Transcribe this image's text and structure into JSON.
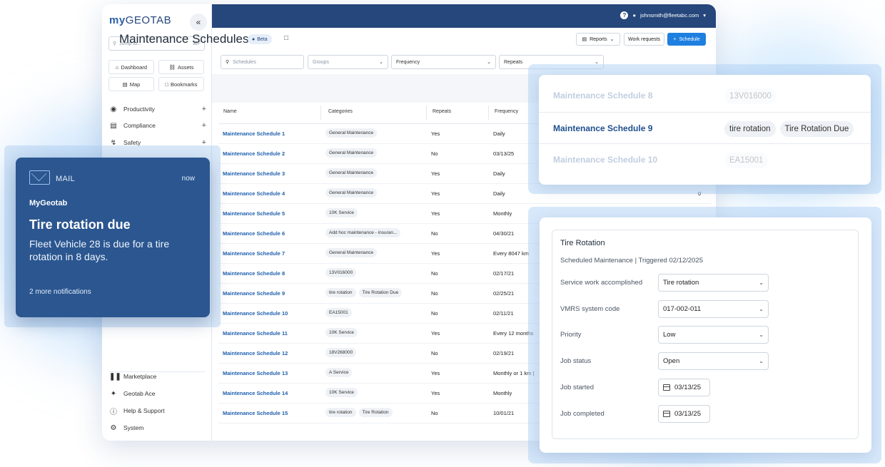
{
  "logo": {
    "my": "my",
    "geo": "GEOTAB"
  },
  "sidebar": {
    "collapse": "«",
    "jump_placeholder": "Jump to...",
    "jump_kbd": "⌘F",
    "quick": [
      {
        "label": "Dashboard",
        "icon": "home-icon"
      },
      {
        "label": "Assets",
        "icon": "truck-icon"
      },
      {
        "label": "Map",
        "icon": "map-icon"
      },
      {
        "label": "Bookmarks",
        "icon": "bookmark-icon"
      }
    ],
    "nav": [
      {
        "label": "Productivity",
        "icon": "globe-icon"
      },
      {
        "label": "Compliance",
        "icon": "clipboard-icon"
      },
      {
        "label": "Safety",
        "icon": "route-icon"
      }
    ],
    "bottom": [
      {
        "label": "Marketplace",
        "icon": "marketplace-icon"
      },
      {
        "label": "Geotab Ace",
        "icon": "sparkle-icon"
      },
      {
        "label": "Help & Support",
        "icon": "help-icon"
      },
      {
        "label": "System",
        "icon": "gear-icon"
      }
    ]
  },
  "topbar": {
    "help": "?",
    "user": "johnsmith@fleetabc.com",
    "caret": "▾"
  },
  "page": {
    "title": "Maintenance Schedules",
    "beta": "Beta",
    "reports": "Reports",
    "work_requests": "Work requests",
    "schedule": "Schedule"
  },
  "filters": {
    "schedules": "Schedules",
    "groups": "Groups",
    "frequency": "Frequency",
    "repeats": "Repeats"
  },
  "table": {
    "headers": {
      "name": "Name",
      "categories": "Categories",
      "repeats": "Repeats",
      "frequency": "Frequency"
    },
    "rows": [
      {
        "name": "Maintenance Schedule 1",
        "cats": [
          "General Maintenance"
        ],
        "repeats": "Yes",
        "freq": "Daily",
        "count": ""
      },
      {
        "name": "Maintenance Schedule 2",
        "cats": [
          "General Maintenance"
        ],
        "repeats": "No",
        "freq": "03/13/25",
        "count": ""
      },
      {
        "name": "Maintenance Schedule 3",
        "cats": [
          "General Maintenance"
        ],
        "repeats": "Yes",
        "freq": "Daily",
        "count": ""
      },
      {
        "name": "Maintenance Schedule 4",
        "cats": [
          "General Maintenance"
        ],
        "repeats": "Yes",
        "freq": "Daily",
        "count": "0"
      },
      {
        "name": "Maintenance Schedule 5",
        "cats": [
          "10K Service"
        ],
        "repeats": "Yes",
        "freq": "Monthly",
        "count": ""
      },
      {
        "name": "Maintenance Schedule 6",
        "cats": [
          "Add hoc maintenance - insuran..."
        ],
        "repeats": "No",
        "freq": "04/30/21",
        "count": ""
      },
      {
        "name": "Maintenance Schedule 7",
        "cats": [
          "General Maintenance"
        ],
        "repeats": "Yes",
        "freq": "Every 8047 km",
        "count": ""
      },
      {
        "name": "Maintenance Schedule 8",
        "cats": [
          "13V016000"
        ],
        "repeats": "No",
        "freq": "02/17/21",
        "count": ""
      },
      {
        "name": "Maintenance Schedule 9",
        "cats": [
          "tire rotation",
          "Tire Rotation Due"
        ],
        "repeats": "No",
        "freq": "02/25/21",
        "count": ""
      },
      {
        "name": "Maintenance Schedule 10",
        "cats": [
          "EA15001"
        ],
        "repeats": "No",
        "freq": "02/11/21",
        "count": ""
      },
      {
        "name": "Maintenance Schedule 11",
        "cats": [
          "10K Service"
        ],
        "repeats": "Yes",
        "freq": "Every 12 months",
        "count": ""
      },
      {
        "name": "Maintenance Schedule 12",
        "cats": [
          "18V268000"
        ],
        "repeats": "No",
        "freq": "02/19/21",
        "count": ""
      },
      {
        "name": "Maintenance Schedule 13",
        "cats": [
          "A Service"
        ],
        "repeats": "Yes",
        "freq": "Monthly or 1 km (",
        "count": ""
      },
      {
        "name": "Maintenance Schedule 14",
        "cats": [
          "10K Service"
        ],
        "repeats": "Yes",
        "freq": "Monthly",
        "count": ""
      },
      {
        "name": "Maintenance Schedule 15",
        "cats": [
          "tire rotation",
          "Tire Rotation"
        ],
        "repeats": "No",
        "freq": "10/01/21",
        "count": ""
      }
    ]
  },
  "notification": {
    "app": "MAIL",
    "time": "now",
    "sender": "MyGeotab",
    "title": "Tire rotation due",
    "body": "Fleet Vehicle 28 is due for a tire rotation in 8 days.",
    "more": "2 more notifications"
  },
  "schedule_card": {
    "rows": [
      {
        "name": "Maintenance Schedule 8",
        "cats": [
          "13V016000"
        ]
      },
      {
        "name": "Maintenance Schedule 9",
        "cats": [
          "tire rotation",
          "Tire Rotation Due"
        ]
      },
      {
        "name": "Maintenance Schedule 10",
        "cats": [
          "EA15001"
        ]
      }
    ]
  },
  "form": {
    "title": "Tire Rotation",
    "subtitle": "Scheduled Maintenance | Triggered 02/12/2025",
    "fields": {
      "service_label": "Service work accomplished",
      "service_value": "Tire rotation",
      "vmrs_label": "VMRS system code",
      "vmrs_value": "017-002-011",
      "priority_label": "Priority",
      "priority_value": "Low",
      "status_label": "Job status",
      "status_value": "Open",
      "started_label": "Job started",
      "started_value": "03/13/25",
      "completed_label": "Job completed",
      "completed_value": "03/13/25"
    }
  }
}
